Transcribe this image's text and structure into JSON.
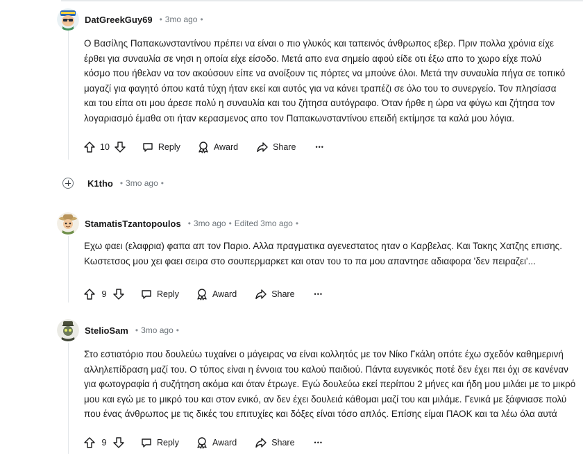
{
  "comments": [
    {
      "username": "DatGreekGuy69",
      "time": "3mo ago",
      "edited": "",
      "body": "Ο Βασίλης Παπακωνσταντίνου πρέπει να είναι ο πιο γλυκός και ταπεινός άνθρωπος εβερ. Πριν πολλα χρόνια είχε έρθει για συναυλία σε νησι η οποία είχε είσοδο. Μετά απο ενα σημείο αφού είδε οτι έξω απο το χωρο είχε πολύ κόσμο που ήθελαν να τον ακούσουν είπε να ανοίξουν τις πόρτες να μπούνε όλοι. Μετά την συναυλία πήγα σε τοπικό μαγαζί για φαγητό όπου κατά τύχη ήταν εκεί και αυτός για να κάνει τραπέζι σε όλο του το συνεργείο. Τον πλησίασα και του είπα οτι μου άρεσε πολύ η συναυλία και του ζήτησα αυτόγραφο. Όταν ήρθε η ώρα να φύγω και ζήτησα τον λογαριασμό έμαθα οτι ήταν κερασμενος απο τον Παπακωνσταντίνου επειδή εκτίμησε τα καλά μου λόγια.",
      "votes": "10",
      "reply": "Reply",
      "award": "Award",
      "share": "Share"
    },
    {
      "username": "StamatisTzantopoulos",
      "time": "3mo ago",
      "edited": "Edited 3mo ago",
      "body": "Εχω φαει (ελαφρια) φαπα απ τον Παριο. Αλλα πραγματικα αγενεστατος ηταν ο Καρβελας. Και Τακης Χατζης επισης. Κωστετσος μου χει φαει σειρα στο σουπερμαρκετ και οταν του το πα μου απαντησε αδιαφορα 'δεν πειραζει'...",
      "votes": "9",
      "reply": "Reply",
      "award": "Award",
      "share": "Share"
    },
    {
      "username": "StelioSam",
      "time": "3mo ago",
      "edited": "",
      "body": "Στο εστιατόριο που δουλεύω τυχαίνει ο μάγειρας να είναι κολλητός με τον Νίκο Γκάλη οπότε έχω σχεδόν καθημερινή αλληλεπίδραση μαζί του. Ο τύπος είναι η έννοια του καλού παιδιού. Πάντα ευγενικός ποτέ δεν έχει πει όχι σε κανέναν για φωτογραφία ή συζήτηση ακόμα και όταν έτρωγε. Εγώ δουλεύω εκεί περίπου 2 μήνες και ήδη μου μιλάει με το μικρό μου και εγώ με το μικρό του και στον ενικό, αν δεν έχει δουλειά κάθομαι μαζί του και μιλάμε. Γενικά με ξάφνιασε πολύ που ένας άνθρωπος με τις δικές του επιτυχίες και δόξες είναι τόσο απλός. Επίσης είμαι ΠΑΟΚ και τα λέω όλα αυτά",
      "votes": "9",
      "reply": "Reply",
      "award": "Award",
      "share": "Share"
    }
  ],
  "collapsed": {
    "username": "K1tho",
    "time": "3mo ago"
  },
  "separator_dot": "•",
  "more_label": "•••",
  "colors": {
    "text": "#1a1a1b",
    "meta": "#6b7278",
    "line": "#e4e7ea"
  }
}
